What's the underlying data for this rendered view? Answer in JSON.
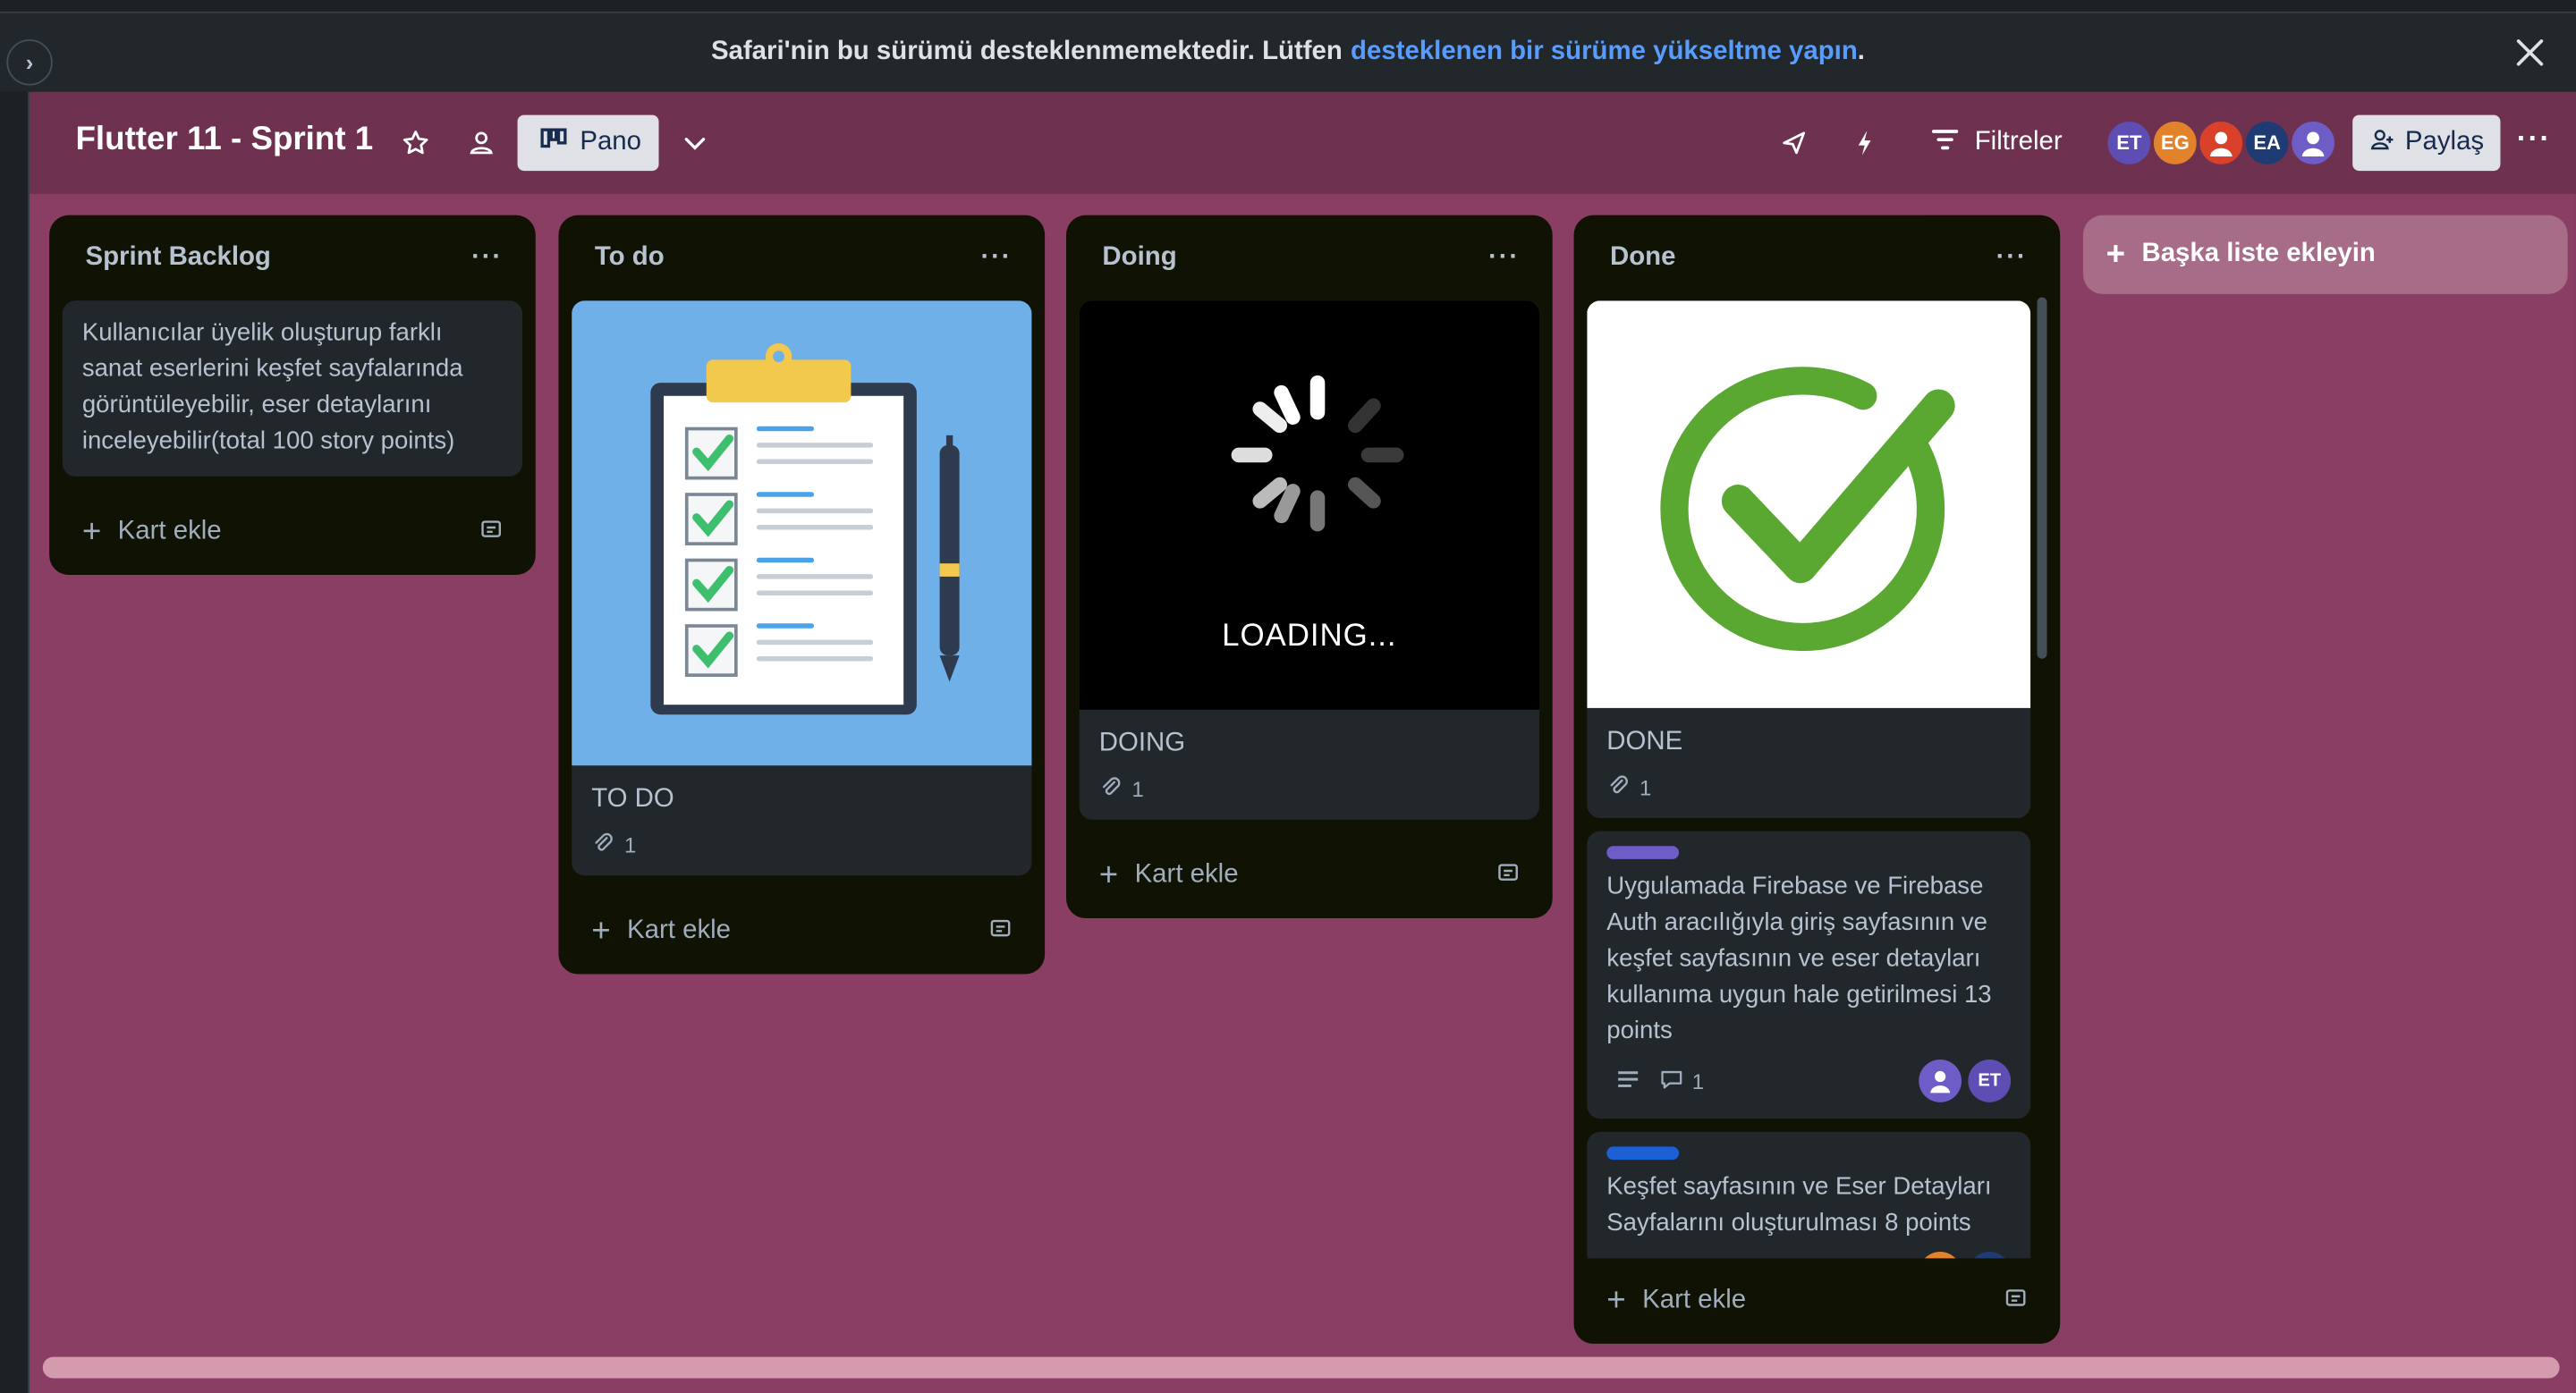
{
  "banner": {
    "text": "Safari'nin bu sürümü desteklenmemektedir. Lütfen",
    "link": "desteklenen bir sürüme yükseltme yapın",
    "suffix": "."
  },
  "header": {
    "title": "Flutter 11 - Sprint 1",
    "view_label": "Pano",
    "filters_label": "Filtreler",
    "share_label": "Paylaş",
    "members": [
      {
        "initials": "ET",
        "color": "#5e4db2"
      },
      {
        "initials": "EG",
        "color": "#e2832c"
      },
      {
        "initials": "",
        "color": "#d9412b"
      },
      {
        "initials": "EA",
        "color": "#1f3b73"
      },
      {
        "initials": "",
        "color": "#6e5dc6"
      }
    ]
  },
  "lists": [
    {
      "title": "Sprint Backlog",
      "card_text": "Kullanıcılar üyelik oluşturup farklı sanat eserlerini keşfet sayfalarında görüntüleyebilir, eser detaylarını inceleyebilir(total 100 story points)",
      "add_label": "Kart ekle"
    },
    {
      "title": "To do",
      "card_title": "TO DO",
      "attachments": "1",
      "add_label": "Kart ekle"
    },
    {
      "title": "Doing",
      "card_title": "DOING",
      "cover_text": "LOADING...",
      "attachments": "1",
      "add_label": "Kart ekle"
    },
    {
      "title": "Done",
      "card_title": "DONE",
      "attachments": "1",
      "card2_text": "Uygulamada Firebase ve Firebase Auth aracılığıyla giriş sayfasının ve keşfet sayfasının ve eser detayları kullanıma uygun hale getirilmesi 13 points",
      "card2_label_color": "#6e5dc6",
      "card2_comments": "1",
      "card2_member": "ET",
      "card3_text": "Keşfet sayfasının ve Eser Detayları Sayfalarını oluşturulması 8 points",
      "card3_label_color": "#1d5fd4",
      "add_label": "Kart ekle"
    }
  ],
  "add_list_label": "Başka liste ekleyin",
  "colors": {
    "board_bg": "#8b3e63",
    "header_bg": "#6e3150",
    "list_bg": "#101204",
    "card_bg": "#22272b",
    "link": "#579dff"
  }
}
